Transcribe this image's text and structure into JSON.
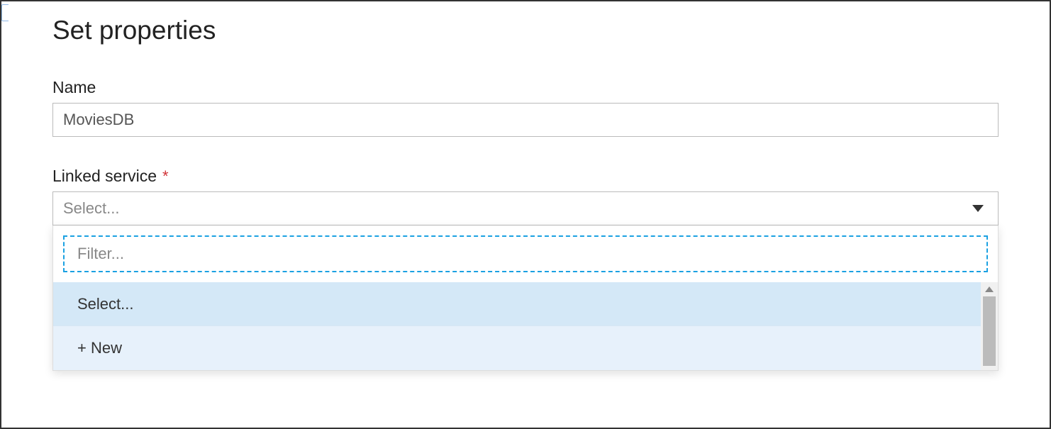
{
  "header": {
    "title": "Set properties"
  },
  "fields": {
    "name": {
      "label": "Name",
      "value": "MoviesDB"
    },
    "linked_service": {
      "label": "Linked service",
      "required_marker": "*",
      "placeholder": "Select..."
    }
  },
  "dropdown": {
    "filter_placeholder": "Filter...",
    "options": {
      "select": "Select...",
      "new": "+ New"
    }
  }
}
